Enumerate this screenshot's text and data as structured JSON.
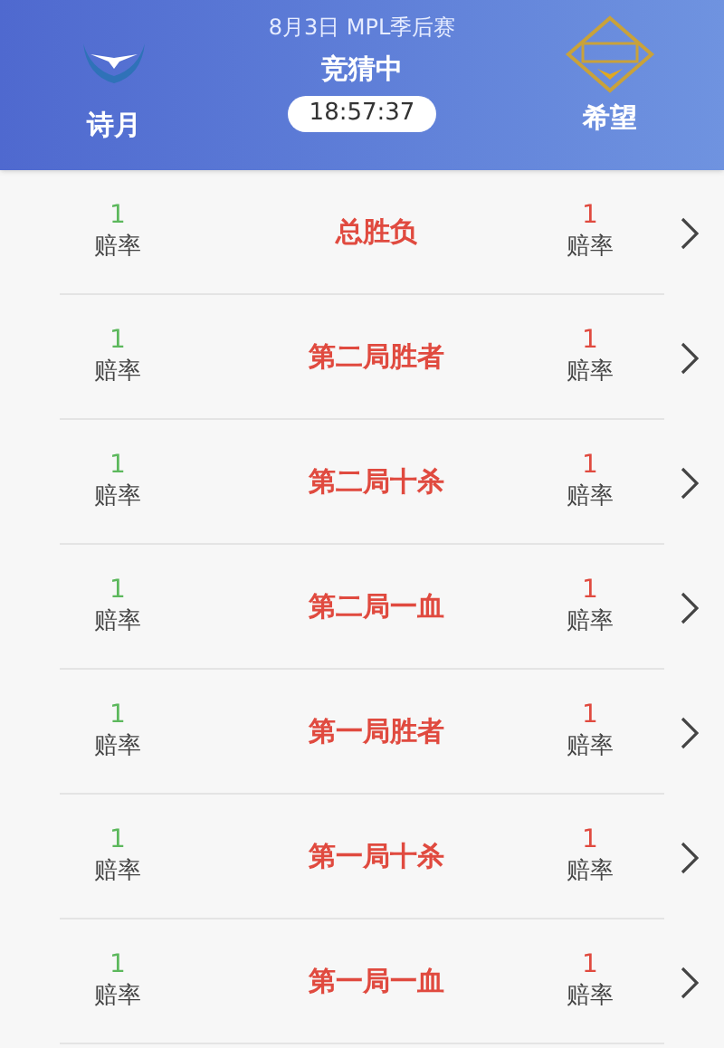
{
  "header": {
    "subtitle": "8月3日 MPL季后赛",
    "status": "竞猜中",
    "time": "18:57:37",
    "team_left": "诗月",
    "team_right": "希望"
  },
  "markets": [
    {
      "title": "总胜负",
      "left_odds": "1",
      "left_label": "赔率",
      "right_odds": "1",
      "right_label": "赔率"
    },
    {
      "title": "第二局胜者",
      "left_odds": "1",
      "left_label": "赔率",
      "right_odds": "1",
      "right_label": "赔率"
    },
    {
      "title": "第二局十杀",
      "left_odds": "1",
      "left_label": "赔率",
      "right_odds": "1",
      "right_label": "赔率"
    },
    {
      "title": "第二局一血",
      "left_odds": "1",
      "left_label": "赔率",
      "right_odds": "1",
      "right_label": "赔率"
    },
    {
      "title": "第一局胜者",
      "left_odds": "1",
      "left_label": "赔率",
      "right_odds": "1",
      "right_label": "赔率"
    },
    {
      "title": "第一局十杀",
      "left_odds": "1",
      "left_label": "赔率",
      "right_odds": "1",
      "right_label": "赔率"
    },
    {
      "title": "第一局一血",
      "left_odds": "1",
      "left_label": "赔率",
      "right_odds": "1",
      "right_label": "赔率"
    }
  ]
}
